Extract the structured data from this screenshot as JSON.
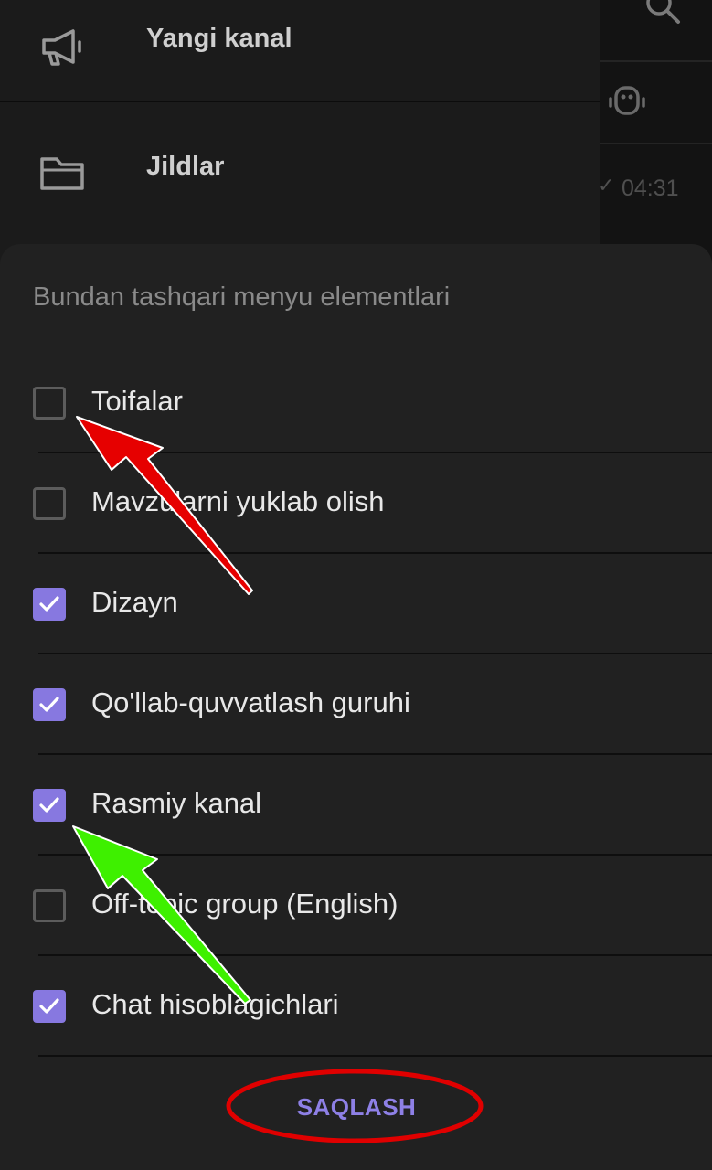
{
  "drawer": {
    "items": [
      {
        "label": "Yangi kanal",
        "icon": "megaphone-icon"
      },
      {
        "label": "Jildlar",
        "icon": "folder-icon"
      }
    ]
  },
  "chat": {
    "time": "04:31"
  },
  "sheet": {
    "title": "Bundan tashqari menyu elementlari",
    "options": [
      {
        "label": "Toifalar",
        "checked": false
      },
      {
        "label": "Mavzularni yuklab olish",
        "checked": false
      },
      {
        "label": "Dizayn",
        "checked": true
      },
      {
        "label": "Qo'llab-quvvatlash guruhi",
        "checked": true
      },
      {
        "label": "Rasmiy kanal",
        "checked": true
      },
      {
        "label": "Off-topic group (English)",
        "checked": false
      },
      {
        "label": "Chat hisoblagichlari",
        "checked": true
      }
    ],
    "save_label": "SAQLASH"
  },
  "colors": {
    "accent": "#8778e0",
    "arrow_red": "#e60000",
    "arrow_green": "#3ef000",
    "highlight_ring": "#e00000"
  }
}
